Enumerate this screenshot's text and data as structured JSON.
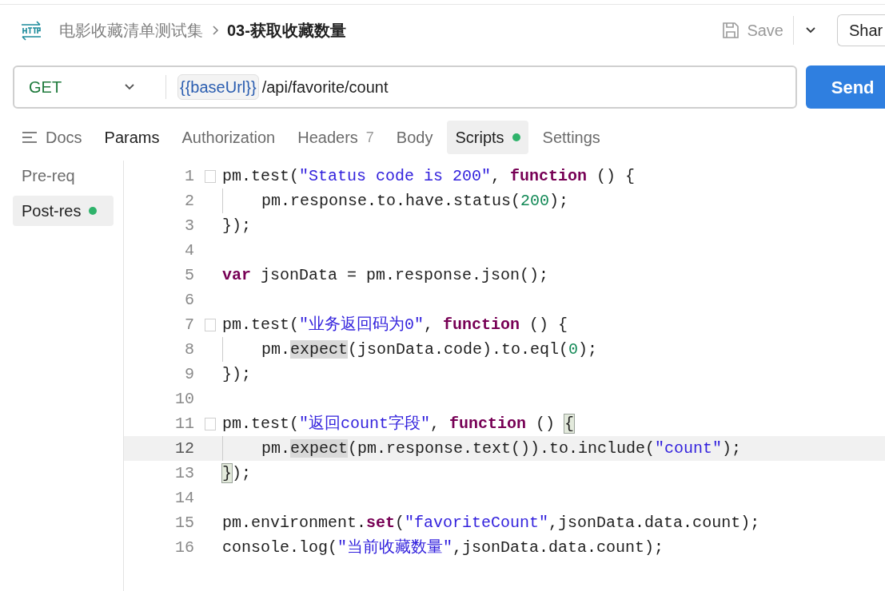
{
  "header": {
    "breadcrumb_parent": "电影收藏清单测试集",
    "title": "03-获取收藏数量",
    "save_label": "Save",
    "share_label": "Shar"
  },
  "request": {
    "method": "GET",
    "variable": "{{baseUrl}}",
    "path": "/api/favorite/count",
    "send_label": "Send"
  },
  "tabs": [
    {
      "label": "Docs",
      "kind": "docs",
      "selected": false
    },
    {
      "label": "Params",
      "kind": "plain",
      "selected": false
    },
    {
      "label": "Authorization",
      "kind": "plain",
      "selected": false
    },
    {
      "label": "Headers",
      "kind": "count",
      "count": "7",
      "selected": false
    },
    {
      "label": "Body",
      "kind": "plain",
      "selected": false
    },
    {
      "label": "Scripts",
      "kind": "dot",
      "selected": true
    },
    {
      "label": "Settings",
      "kind": "plain",
      "selected": false
    }
  ],
  "script_tabs": [
    {
      "label": "Pre-req",
      "has_script": false,
      "selected": false
    },
    {
      "label": "Post-res",
      "has_script": true,
      "selected": true
    }
  ],
  "code": [
    {
      "number": "1",
      "foldable": true,
      "current": false,
      "indent": false,
      "tokens": [
        {
          "t": "pm.test(",
          "kind": "plain"
        },
        {
          "t": "\"Status code is 200\"",
          "kind": "string"
        },
        {
          "t": ", ",
          "kind": "plain"
        },
        {
          "t": "function",
          "kind": "keyword"
        },
        {
          "t": " () {",
          "kind": "plain"
        }
      ]
    },
    {
      "number": "2",
      "foldable": false,
      "current": false,
      "indent": true,
      "tokens": [
        {
          "t": "pm.response.to.have.status(",
          "kind": "plain"
        },
        {
          "t": "200",
          "kind": "number"
        },
        {
          "t": ");",
          "kind": "plain"
        }
      ]
    },
    {
      "number": "3",
      "foldable": false,
      "current": false,
      "indent": false,
      "tokens": [
        {
          "t": "});",
          "kind": "plain"
        }
      ]
    },
    {
      "number": "4",
      "foldable": false,
      "current": false,
      "indent": false
    },
    {
      "number": "5",
      "foldable": false,
      "current": false,
      "indent": false,
      "tokens": [
        {
          "t": "var",
          "kind": "keyword"
        },
        {
          "t": " jsonData = pm.response.json();",
          "kind": "plain"
        }
      ]
    },
    {
      "number": "6",
      "foldable": false,
      "current": false,
      "indent": false
    },
    {
      "number": "7",
      "foldable": true,
      "current": false,
      "indent": false,
      "tokens": [
        {
          "t": "pm.test(",
          "kind": "plain"
        },
        {
          "t": "\"业务返回码为0\"",
          "kind": "string"
        },
        {
          "t": ", ",
          "kind": "plain"
        },
        {
          "t": "function",
          "kind": "keyword"
        },
        {
          "t": " () {",
          "kind": "plain"
        }
      ]
    },
    {
      "number": "8",
      "foldable": false,
      "current": false,
      "indent": true,
      "tokens": [
        {
          "t": "pm.",
          "kind": "plain"
        },
        {
          "t": "expect",
          "kind": "occurrence"
        },
        {
          "t": "(jsonData.code).to.eql(",
          "kind": "plain"
        },
        {
          "t": "0",
          "kind": "number"
        },
        {
          "t": ");",
          "kind": "plain"
        }
      ]
    },
    {
      "number": "9",
      "foldable": false,
      "current": false,
      "indent": false,
      "tokens": [
        {
          "t": "});",
          "kind": "plain"
        }
      ]
    },
    {
      "number": "10",
      "foldable": false,
      "current": false,
      "indent": false
    },
    {
      "number": "11",
      "foldable": true,
      "current": false,
      "indent": false,
      "tokens": [
        {
          "t": "pm.test(",
          "kind": "plain"
        },
        {
          "t": "\"返回count字段\"",
          "kind": "string"
        },
        {
          "t": ", ",
          "kind": "plain"
        },
        {
          "t": "function",
          "kind": "keyword"
        },
        {
          "t": " () ",
          "kind": "plain"
        },
        {
          "t": "{",
          "kind": "bracket"
        }
      ]
    },
    {
      "number": "12",
      "foldable": false,
      "current": true,
      "indent": true,
      "tokens": [
        {
          "t": "pm.",
          "kind": "plain"
        },
        {
          "t": "expect",
          "kind": "occurrence"
        },
        {
          "t": "(pm.response.text()).to.include(",
          "kind": "plain"
        },
        {
          "t": "\"count\"",
          "kind": "string"
        },
        {
          "t": ");",
          "kind": "plain"
        }
      ]
    },
    {
      "number": "13",
      "foldable": false,
      "current": false,
      "indent": false,
      "tokens": [
        {
          "t": "}",
          "kind": "bracket"
        },
        {
          "t": ");",
          "kind": "plain"
        }
      ]
    },
    {
      "number": "14",
      "foldable": false,
      "current": false,
      "indent": false
    },
    {
      "number": "15",
      "foldable": false,
      "current": false,
      "indent": false,
      "tokens": [
        {
          "t": "pm.environment.",
          "kind": "plain"
        },
        {
          "t": "set",
          "kind": "keyword"
        },
        {
          "t": "(",
          "kind": "plain"
        },
        {
          "t": "\"favoriteCount\"",
          "kind": "string"
        },
        {
          "t": ",jsonData.data.count);",
          "kind": "plain"
        }
      ]
    },
    {
      "number": "16",
      "foldable": false,
      "current": false,
      "indent": false,
      "tokens": [
        {
          "t": "console.log(",
          "kind": "plain"
        },
        {
          "t": "\"当前收藏数量\"",
          "kind": "string"
        },
        {
          "t": ",jsonData.data.count);",
          "kind": "plain"
        }
      ]
    }
  ]
}
